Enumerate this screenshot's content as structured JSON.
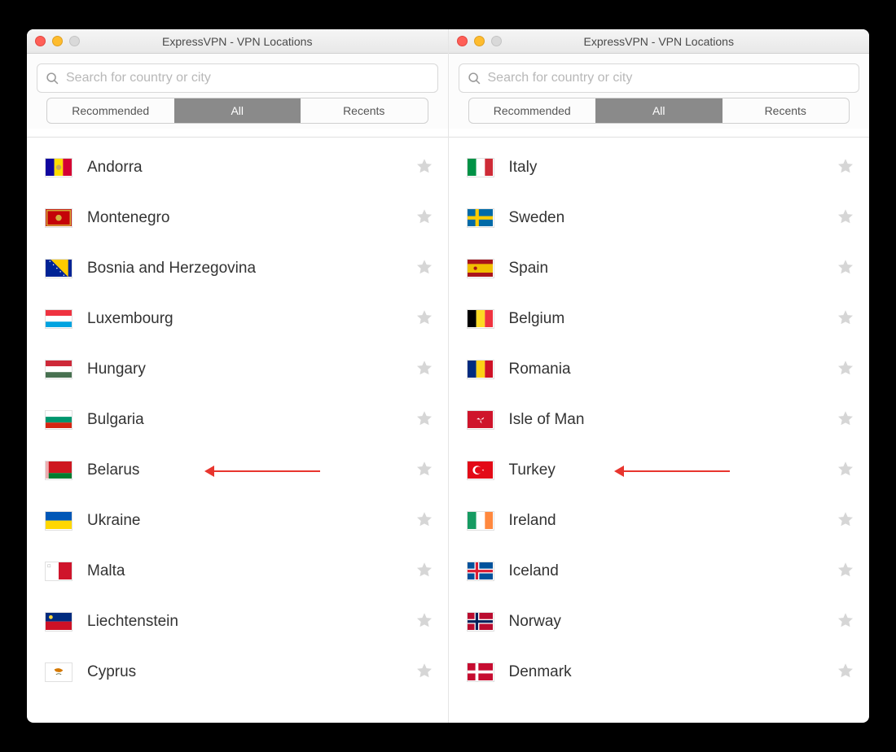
{
  "window_title": "ExpressVPN - VPN Locations",
  "search": {
    "placeholder": "Search for country or city"
  },
  "tabs": {
    "recommended": "Recommended",
    "all": "All",
    "recents": "Recents",
    "active": "all"
  },
  "left": {
    "items": [
      {
        "name": "Andorra",
        "flag": "andorra"
      },
      {
        "name": "Montenegro",
        "flag": "montenegro"
      },
      {
        "name": "Bosnia and Herzegovina",
        "flag": "bosnia"
      },
      {
        "name": "Luxembourg",
        "flag": "luxembourg"
      },
      {
        "name": "Hungary",
        "flag": "hungary"
      },
      {
        "name": "Bulgaria",
        "flag": "bulgaria"
      },
      {
        "name": "Belarus",
        "flag": "belarus",
        "annotated": true
      },
      {
        "name": "Ukraine",
        "flag": "ukraine"
      },
      {
        "name": "Malta",
        "flag": "malta"
      },
      {
        "name": "Liechtenstein",
        "flag": "liechtenstein"
      },
      {
        "name": "Cyprus",
        "flag": "cyprus"
      }
    ]
  },
  "right": {
    "items": [
      {
        "name": "Italy",
        "flag": "italy",
        "expandable": true
      },
      {
        "name": "Sweden",
        "flag": "sweden"
      },
      {
        "name": "Spain",
        "flag": "spain",
        "expandable": true
      },
      {
        "name": "Belgium",
        "flag": "belgium"
      },
      {
        "name": "Romania",
        "flag": "romania"
      },
      {
        "name": "Isle of Man",
        "flag": "isleofman"
      },
      {
        "name": "Turkey",
        "flag": "turkey",
        "annotated": true
      },
      {
        "name": "Ireland",
        "flag": "ireland"
      },
      {
        "name": "Iceland",
        "flag": "iceland"
      },
      {
        "name": "Norway",
        "flag": "norway"
      },
      {
        "name": "Denmark",
        "flag": "denmark"
      }
    ]
  }
}
